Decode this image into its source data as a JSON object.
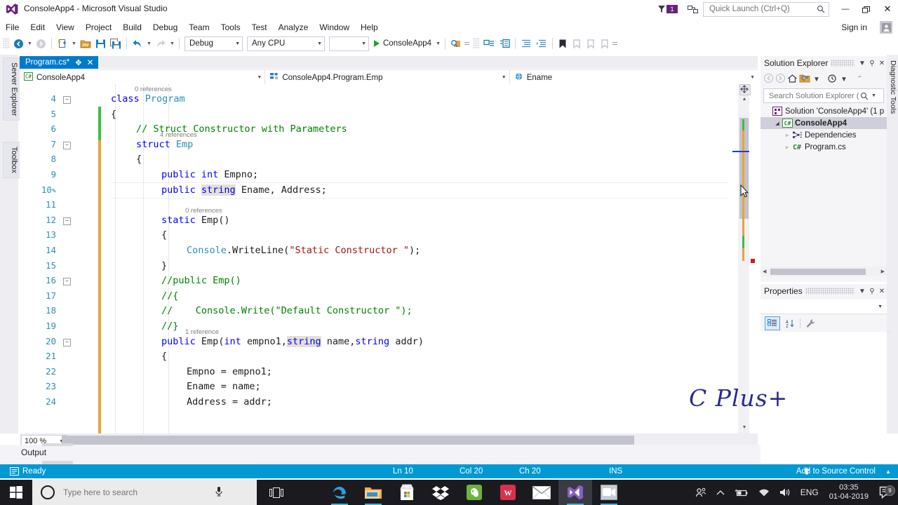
{
  "window": {
    "title": "ConsoleApp4 - Microsoft Visual Studio",
    "feedback_badge": "1",
    "sign_in": "Sign in",
    "minimize": "—",
    "restore": "❐",
    "close": "✕"
  },
  "quick_launch": {
    "placeholder": "Quick Launch (Ctrl+Q)",
    "value": ""
  },
  "menu": {
    "items": [
      "File",
      "Edit",
      "View",
      "Project",
      "Build",
      "Debug",
      "Team",
      "Tools",
      "Test",
      "Analyze",
      "Window",
      "Help"
    ]
  },
  "toolbar": {
    "configuration": "Debug",
    "platform": "Any CPU",
    "run_target": "ConsoleApp4",
    "icons": [
      "navigate-back-icon",
      "navigate-forward-icon",
      "new-project-icon",
      "open-file-icon",
      "save-icon",
      "save-all-icon",
      "undo-icon",
      "redo-icon",
      "find-in-files-icon",
      "comment-icon",
      "uncomment-icon",
      "decrease-indent-icon",
      "increase-indent-icon",
      "toggle-bookmark-icon",
      "previous-bookmark-icon",
      "next-bookmark-icon",
      "clear-bookmarks-icon"
    ]
  },
  "left_rail": {
    "tabs": [
      "Server Explorer",
      "Toolbox"
    ]
  },
  "right_rail": {
    "tabs": [
      "Diagnostic Tools"
    ]
  },
  "editor": {
    "tab_label": "Program.cs*",
    "tab_pin": "✥",
    "tab_close": "✕",
    "nav_project": "ConsoleApp4",
    "nav_type": "ConsoleApp4.Program.Emp",
    "nav_member": "Ename",
    "zoom_level": "100 %",
    "lines": [
      {
        "num": "4",
        "indent": 0,
        "fold": "collapse",
        "ref": "0 references",
        "tokens": [
          {
            "t": "class ",
            "c": "k"
          },
          {
            "t": "Program",
            "c": "t"
          }
        ]
      },
      {
        "num": "5",
        "indent": 0,
        "tokens": [
          {
            "t": "{",
            "c": "p"
          }
        ]
      },
      {
        "num": "6",
        "indent": 1,
        "tokens": [
          {
            "t": "// Struct Constructor with Parameters",
            "c": "c"
          }
        ]
      },
      {
        "num": "7",
        "indent": 1,
        "fold": "collapse",
        "ref": "4 references",
        "tokens": [
          {
            "t": "struct ",
            "c": "k"
          },
          {
            "t": "Emp",
            "c": "t"
          }
        ]
      },
      {
        "num": "8",
        "indent": 1,
        "tokens": [
          {
            "t": "{",
            "c": "p"
          }
        ]
      },
      {
        "num": "9",
        "indent": 2,
        "tokens": [
          {
            "t": "public ",
            "c": "k"
          },
          {
            "t": "int ",
            "c": "k"
          },
          {
            "t": "Empno;",
            "c": "p"
          }
        ]
      },
      {
        "num": "10",
        "indent": 2,
        "edited": true,
        "current": true,
        "tokens": [
          {
            "t": "public ",
            "c": "k"
          },
          {
            "t": "string",
            "c": "k hl"
          },
          {
            "t": " Ename, Address;",
            "c": "p"
          }
        ]
      },
      {
        "num": "11",
        "indent": 0,
        "tokens": []
      },
      {
        "num": "12",
        "indent": 2,
        "fold": "collapse",
        "ref": "0 references",
        "tokens": [
          {
            "t": "static ",
            "c": "k"
          },
          {
            "t": "Emp()",
            "c": "p"
          }
        ]
      },
      {
        "num": "13",
        "indent": 2,
        "tokens": [
          {
            "t": "{",
            "c": "p"
          }
        ]
      },
      {
        "num": "14",
        "indent": 3,
        "tokens": [
          {
            "t": "Console",
            "c": "t"
          },
          {
            "t": ".WriteLine(",
            "c": "p"
          },
          {
            "t": "\"Static Constructor \"",
            "c": "s"
          },
          {
            "t": ");",
            "c": "p"
          }
        ]
      },
      {
        "num": "15",
        "indent": 2,
        "tokens": [
          {
            "t": "}",
            "c": "p"
          }
        ]
      },
      {
        "num": "16",
        "indent": 2,
        "fold": "collapse",
        "tokens": [
          {
            "t": "//public Emp()",
            "c": "c"
          }
        ]
      },
      {
        "num": "17",
        "indent": 2,
        "tokens": [
          {
            "t": "//{",
            "c": "c"
          }
        ]
      },
      {
        "num": "18",
        "indent": 2,
        "tokens": [
          {
            "t": "//    Console.Write(\"Default Constructor \");",
            "c": "c"
          }
        ]
      },
      {
        "num": "19",
        "indent": 2,
        "tokens": [
          {
            "t": "//}",
            "c": "c"
          }
        ]
      },
      {
        "num": "20",
        "indent": 2,
        "fold": "collapse",
        "ref": "1 reference",
        "tokens": [
          {
            "t": "public ",
            "c": "k"
          },
          {
            "t": "Emp(",
            "c": "p"
          },
          {
            "t": "int",
            "c": "k"
          },
          {
            "t": " empno1,",
            "c": "p"
          },
          {
            "t": "string",
            "c": "k hl"
          },
          {
            "t": " name,",
            "c": "p"
          },
          {
            "t": "string",
            "c": "k"
          },
          {
            "t": " addr)",
            "c": "p"
          }
        ]
      },
      {
        "num": "21",
        "indent": 2,
        "tokens": [
          {
            "t": "{",
            "c": "p"
          }
        ]
      },
      {
        "num": "22",
        "indent": 3,
        "tokens": [
          {
            "t": "Empno = empno1;",
            "c": "p"
          }
        ]
      },
      {
        "num": "23",
        "indent": 3,
        "tokens": [
          {
            "t": "Ename = name;",
            "c": "p"
          }
        ]
      },
      {
        "num": "24",
        "indent": 3,
        "tokens": [
          {
            "t": "Address = addr;",
            "c": "p"
          }
        ]
      }
    ]
  },
  "output_panel": {
    "label": "Output"
  },
  "solution_explorer": {
    "title": "Solution Explorer",
    "search_placeholder": "Search Solution Explorer (C",
    "toolbar_icons": [
      "back-icon",
      "forward-icon",
      "home-icon",
      "sync-with-active-document-icon",
      "pending-changes-icon",
      "overflow-icon"
    ],
    "tree": [
      {
        "label": "Solution 'ConsoleApp4' (1 p",
        "depth": 0,
        "arrow": "",
        "icon": "solution-icon",
        "selected": false
      },
      {
        "label": "ConsoleApp4",
        "depth": 1,
        "arrow": "◢",
        "icon": "csharp-project-icon",
        "selected": true
      },
      {
        "label": "Dependencies",
        "depth": 2,
        "arrow": "▹",
        "icon": "dependencies-icon",
        "selected": false
      },
      {
        "label": "Program.cs",
        "depth": 2,
        "arrow": "▹",
        "icon": "csharp-file-icon",
        "selected": false
      }
    ]
  },
  "properties": {
    "title": "Properties",
    "toolbar_icons": [
      "categorized-icon",
      "alphabetical-icon",
      "property-pages-icon"
    ]
  },
  "watermark": {
    "text": "C Plus+"
  },
  "status_bar": {
    "ready": "Ready",
    "line": "Ln 10",
    "column": "Col 20",
    "character": "Ch 20",
    "insert_mode": "INS",
    "source_control": "Add to Source Control",
    "source_control_arrow": "▲"
  },
  "taskbar": {
    "search_placeholder": "Type here to search",
    "apps": [
      "task-view-icon",
      "edge-icon",
      "file-explorer-icon",
      "microsoft-store-icon",
      "dropbox-icon",
      "evernote-icon",
      "wps-office-icon",
      "mail-icon",
      "visual-studio-icon",
      "screen-recorder-icon"
    ],
    "tray": {
      "language": "ENG",
      "time": "03:35",
      "date": "01-04-2019",
      "notification_count": "9"
    }
  },
  "colors": {
    "accent_blue": "#007acc",
    "status_blue": "#0099d4",
    "vs_purple": "#68217a",
    "keyword": "#0000ff",
    "type": "#2b91af",
    "comment": "#008000",
    "string": "#a31515",
    "changebar": "#e8a33d",
    "saved_bar": "#3fbf3f"
  }
}
